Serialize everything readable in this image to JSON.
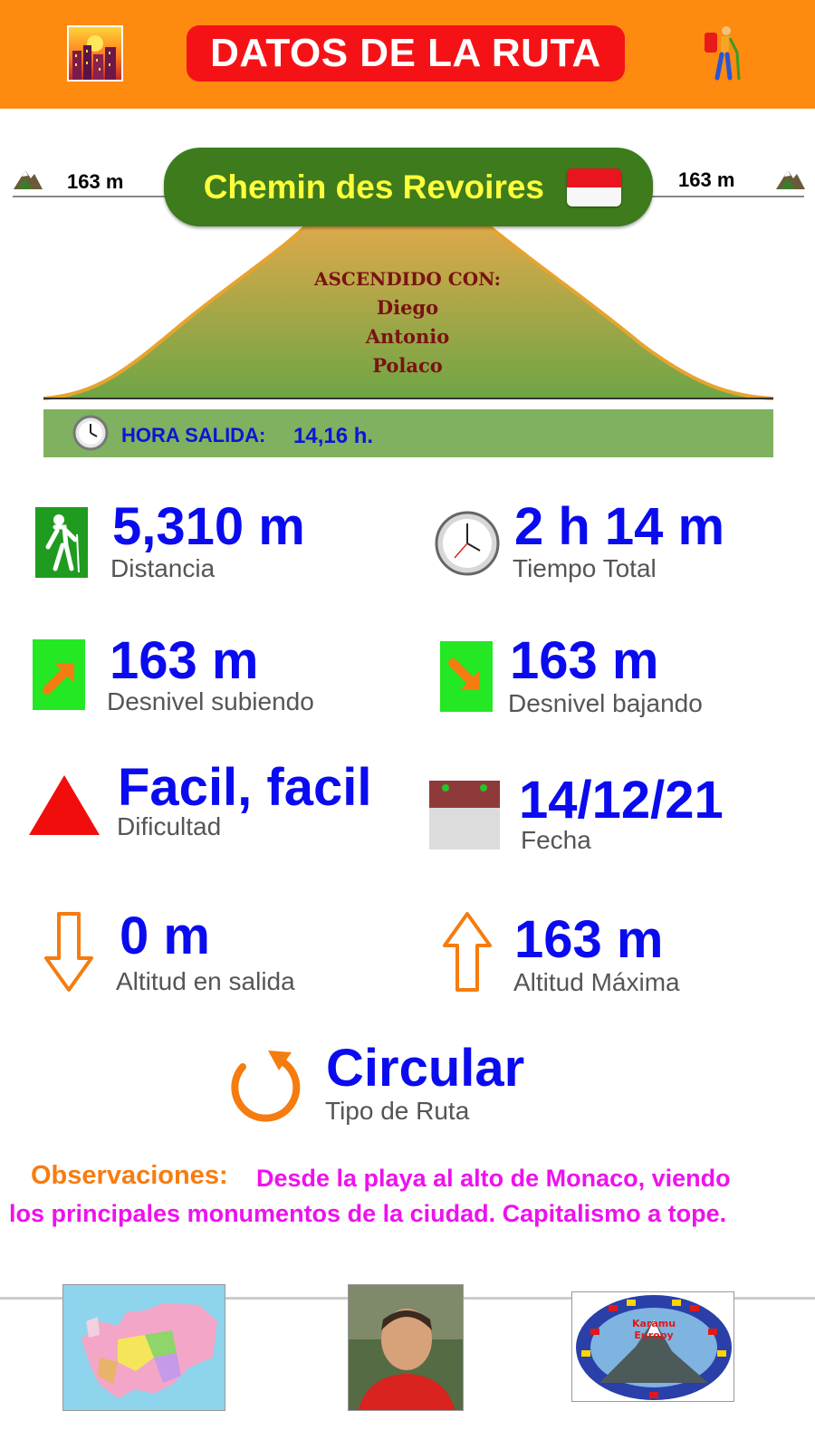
{
  "header": {
    "title": "DATOS DE LA RUTA",
    "color": "#ff8a10",
    "title_bg": "#f51217",
    "left_icon": "city-sunset-icon",
    "right_icon": "hiker-icon"
  },
  "route": {
    "name": "Chemin des Revoires",
    "flag": "monaco-flag-icon",
    "altitude_left": "163 m",
    "altitude_right": "163 m",
    "climbed_title": "ASCENDIDO CON:",
    "companions": [
      "Diego",
      "Antonio",
      "Polaco"
    ],
    "departure_label": "HORA SALIDA:",
    "departure_time": "14,16 h."
  },
  "stats": {
    "distance": {
      "value": "5,310 m",
      "label": "Distancia"
    },
    "total_time": {
      "value": "2 h 14 m",
      "label": "Tiempo Total"
    },
    "ascent": {
      "value": "163 m",
      "label": "Desnivel subiendo"
    },
    "descent": {
      "value": "163 m",
      "label": "Desnivel bajando"
    },
    "difficulty": {
      "value": "Facil, facil",
      "label": "Dificultad"
    },
    "date": {
      "value": "14/12/21",
      "label": "Fecha"
    },
    "start_altitude": {
      "value": "0 m",
      "label": "Altitud en salida"
    },
    "max_altitude": {
      "value": "163 m",
      "label": "Altitud Máxima"
    },
    "route_type": {
      "value": "Circular",
      "label": "Tipo de Ruta"
    }
  },
  "observations": {
    "title": "Observaciones:",
    "line1": "Desde la playa al alto de Monaco, viendo",
    "line2": "los principales monumentos de la ciudad. Capitalismo a tope."
  },
  "footer": {
    "items": [
      "europe-map-thumbnail",
      "profile-photo-thumbnail",
      "europe-flags-logo-thumbnail"
    ],
    "logo_text": [
      "Karamu",
      "Europy"
    ]
  },
  "colors": {
    "value_blue": "#0a0bef",
    "label_gray": "#555555",
    "orange": "#f77c10",
    "magenta": "#ee11ee",
    "banner_green": "#3d7b1c",
    "banner_text": "#ffff3b"
  }
}
